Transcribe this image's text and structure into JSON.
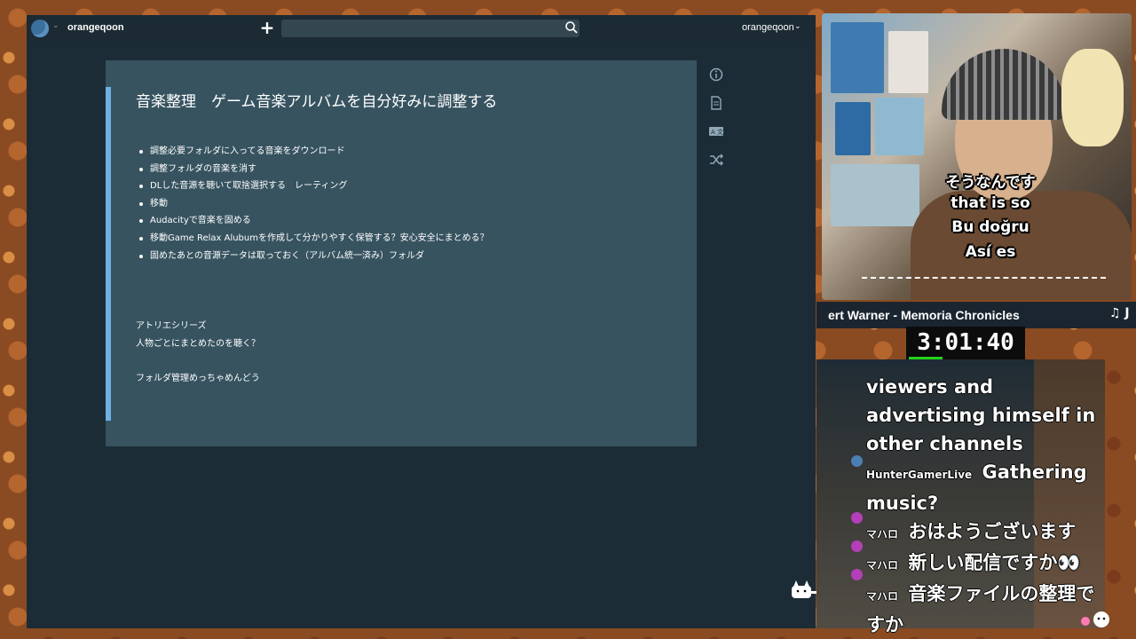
{
  "topbar": {
    "username_left": "orangeqoon",
    "username_right": "orangeqoon",
    "search_placeholder": ""
  },
  "note": {
    "title": "音楽整理　ゲーム音楽アルバムを自分好みに調整する",
    "items": [
      "調整必要フォルダに入ってる音楽をダウンロード",
      "調整フォルダの音楽を消す",
      "DLした音源を聴いて取捨選択する　レーティング",
      "移動",
      "Audacityで音楽を固める",
      "移動Game Relax Alubumを作成して分かりやすく保管する？安心安全にまとめる？",
      "固めたあとの音源データは取っておく（アルバム統一済み）フォルダ"
    ],
    "para1": "アトリエシリーズ",
    "para2": "人物ごとにまとめたのを聴く？",
    "para3": "フォルダ管理めっちゃめんどう"
  },
  "sidebar_icons": [
    "info-icon",
    "document-icon",
    "translate-icon",
    "shuffle-icon"
  ],
  "subtitles": [
    "そうなんです",
    "that is so",
    "Bu doğru",
    "Así es"
  ],
  "now_playing": "ert Warner - Memoria Chronicles",
  "now_playing_next": "♫ J",
  "timer": "3:01:40",
  "chat": [
    {
      "user": "",
      "text": "viewers and advertising himself in other channels",
      "avatar_color": ""
    },
    {
      "user": "HunterGamerLive",
      "text": "Gathering music?",
      "avatar_color": "#4b7fb3"
    },
    {
      "user": "マハロ",
      "text": "おはようございます",
      "avatar_color": "#b43fb8"
    },
    {
      "user": "マハロ",
      "text": "新しい配信ですか👀",
      "avatar_color": "#b43fb8"
    },
    {
      "user": "マハロ",
      "text": "音楽ファイルの整理ですか",
      "avatar_color": "#b43fb8"
    }
  ],
  "colors": {
    "app_bg": "#1c2c36",
    "note_bg": "#375360",
    "accent_border": "#6fb1e3",
    "timer_bar": "#23d21a"
  }
}
